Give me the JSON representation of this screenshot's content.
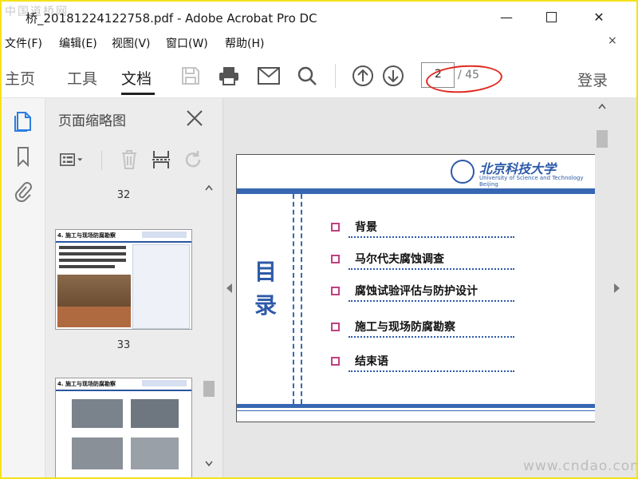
{
  "window": {
    "watermark_top": "中国道桥网",
    "title": "桥_20181224122758.pdf - Adobe Acrobat Pro DC",
    "min_glyph": "—",
    "close_glyph": "✕"
  },
  "menu": {
    "items": [
      "文件(F)",
      "编辑(E)",
      "视图(V)",
      "窗口(W)",
      "帮助(H)"
    ],
    "close_glyph": "×"
  },
  "toolbar": {
    "tabs": [
      "主页",
      "工具",
      "文档"
    ],
    "active_tab": "文档",
    "current_page": "2",
    "page_total": "/ 45",
    "login": "登录"
  },
  "panel": {
    "title": "页面缩略图",
    "page_numbers": [
      "32",
      "33"
    ],
    "thumbs": [
      {
        "heading": "4. 施工与现场防腐勘察"
      },
      {
        "heading": "4. 施工与现场防腐勘察"
      }
    ]
  },
  "slide": {
    "logo_cn": "北京科技大学",
    "logo_en": "University of Science and Technology Beijing",
    "heading": "目录",
    "toc": [
      "背景",
      "马尔代夫腐蚀调查",
      "腐蚀试验评估与防护设计",
      "施工与现场防腐勘察",
      "结束语"
    ]
  },
  "watermark_bottom": "www.cndao.com",
  "colors": {
    "accent_blue": "#3767b3",
    "bullet": "#c04080",
    "annotation": "#e02a20",
    "border": "#f5e21a"
  }
}
